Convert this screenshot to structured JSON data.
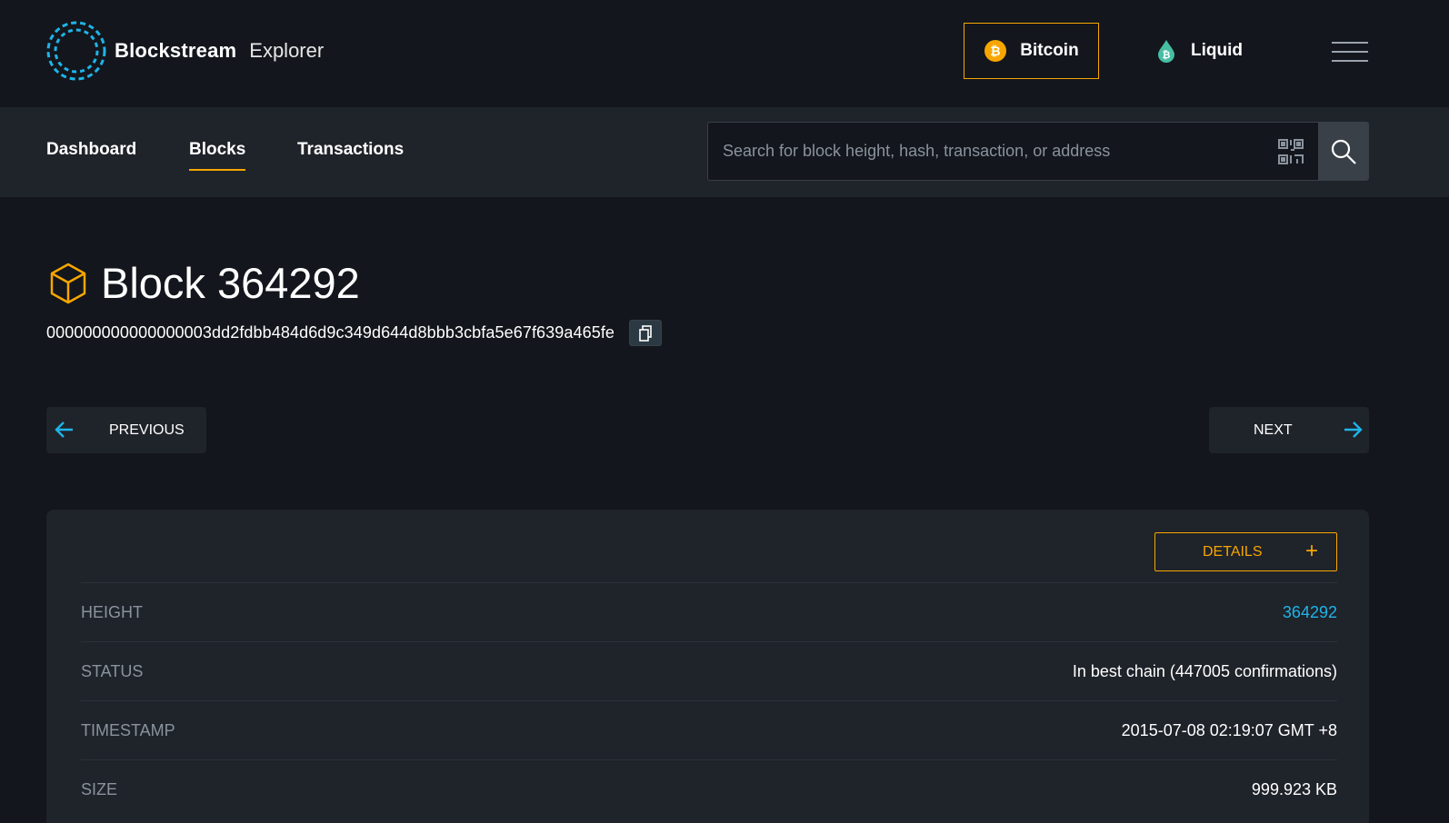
{
  "brand": {
    "name": "Blockstream",
    "product": "Explorer",
    "logo_color": "#1fb4e8"
  },
  "networks": [
    {
      "label": "Bitcoin",
      "icon": "bitcoin-coin-icon",
      "color": "#f7a600",
      "active": true
    },
    {
      "label": "Liquid",
      "icon": "liquid-drop-icon",
      "color": "#46bea4",
      "active": false
    }
  ],
  "nav": {
    "tabs": [
      {
        "label": "Dashboard",
        "active": false
      },
      {
        "label": "Blocks",
        "active": true
      },
      {
        "label": "Transactions",
        "active": false
      }
    ]
  },
  "search": {
    "placeholder": "Search for block height, hash, transaction, or address",
    "value": ""
  },
  "block": {
    "title": "Block 364292",
    "hash": "000000000000000003dd2fdbb484d6d9c349d644d8bbb3cbfa5e67f639a465fe"
  },
  "pager": {
    "previous_label": "PREVIOUS",
    "next_label": "NEXT"
  },
  "details": {
    "toggle_label": "DETAILS",
    "toggle_symbol": "+",
    "rows": [
      {
        "key": "HEIGHT",
        "value": "364292"
      },
      {
        "key": "STATUS",
        "value": "In best chain (447005 confirmations)"
      },
      {
        "key": "TIMESTAMP",
        "value": "2015-07-08 02:19:07 GMT +8"
      },
      {
        "key": "SIZE",
        "value": "999.923 KB"
      }
    ]
  },
  "colors": {
    "accent": "#f7a600",
    "link": "#1fb4e8",
    "background": "#13161c",
    "panel": "#1f232a",
    "muted_text": "#8a939d"
  }
}
